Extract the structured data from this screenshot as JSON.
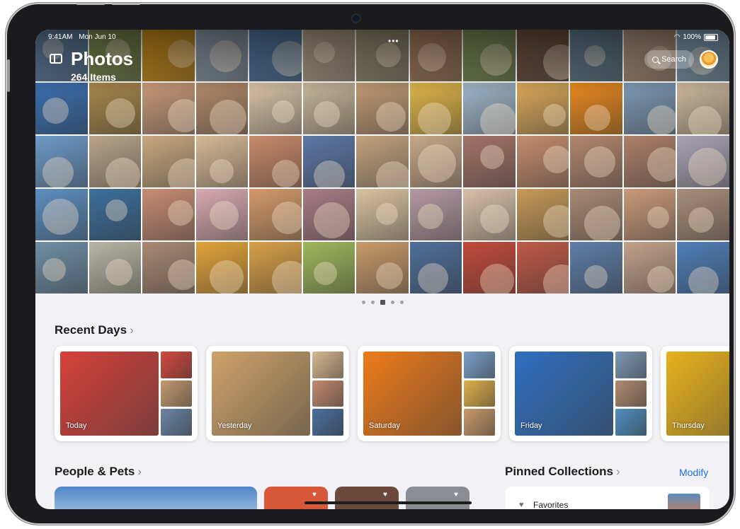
{
  "status_bar": {
    "time": "9:41AM",
    "date": "Mon Jun 10",
    "battery": "100%"
  },
  "header": {
    "title": "Photos",
    "item_count": "264 Items",
    "search_label": "Search"
  },
  "grid_tiles": [
    [
      "#6b8fb5",
      "#8a9a55",
      "#e8a21e",
      "#9fb0c0",
      "#5a86b8",
      "#c9b89a",
      "#a9a07e",
      "#b98e66",
      "#8aa05e",
      "#7b5a44",
      "#6b8a9e",
      "#c6a48a",
      "#8fb0c8"
    ],
    [
      "#3b6fb0",
      "#a8884a",
      "#c99a7a",
      "#b28a6a",
      "#d8c3a6",
      "#c7b79a",
      "#c19a74",
      "#e0b64a",
      "#9fb6c8",
      "#d9a85a",
      "#e8891e",
      "#7d99b5",
      "#cdb99c"
    ],
    [
      "#6e9ac8",
      "#b9a58a",
      "#caa880",
      "#d7b996",
      "#c98a6a",
      "#5c78a6",
      "#c3a27e",
      "#c7a888",
      "#a37468",
      "#c58d6e",
      "#b3876e",
      "#ad8069",
      "#a9a4b4"
    ],
    [
      "#5d8fbf",
      "#3d6f9c",
      "#c78d74",
      "#d8a9b0",
      "#d49a6a",
      "#a97c86",
      "#d9c3a0",
      "#b59aa2",
      "#d7c1a8",
      "#c79a58",
      "#a98a74",
      "#c99a7a",
      "#a88e7a"
    ],
    [
      "#6f8fa6",
      "#b8b6a4",
      "#a98a74",
      "#e2a43a",
      "#d8a048",
      "#9fb85c",
      "#c89a6a",
      "#4f6f9a",
      "#c24b3c",
      "#c05a48",
      "#5e7ea8",
      "#c3a28a",
      "#4f7fb8"
    ]
  ],
  "pager": {
    "active_index": 2,
    "count": 5
  },
  "recent_days": {
    "title": "Recent Days",
    "cards": [
      {
        "label": "Today",
        "main": "#d6403a",
        "side": [
          "#d24a3f",
          "#c49a70",
          "#6a84a6"
        ]
      },
      {
        "label": "Yesterday",
        "main": "#cfa36a",
        "side": [
          "#d8b890",
          "#c28a6e",
          "#4a6f9e"
        ]
      },
      {
        "label": "Saturday",
        "main": "#ee7b1a",
        "side": [
          "#7a9ec8",
          "#e0b04a",
          "#c89a6a"
        ]
      },
      {
        "label": "Friday",
        "main": "#2f6fc0",
        "side": [
          "#7d99b5",
          "#b08a70",
          "#4f8fbf"
        ]
      },
      {
        "label": "Thursday",
        "main": "#e8b21e",
        "side": [
          "#d9a85a",
          "#e8891e",
          "#cdb99c"
        ]
      }
    ]
  },
  "people_pets": {
    "title": "People & Pets"
  },
  "pinned": {
    "title": "Pinned Collections",
    "modify_label": "Modify",
    "favorites_label": "Favorites"
  },
  "colors": {
    "accent": "#1a73e8",
    "background": "#f2f2f6",
    "bezel": "#1b1b1d"
  }
}
